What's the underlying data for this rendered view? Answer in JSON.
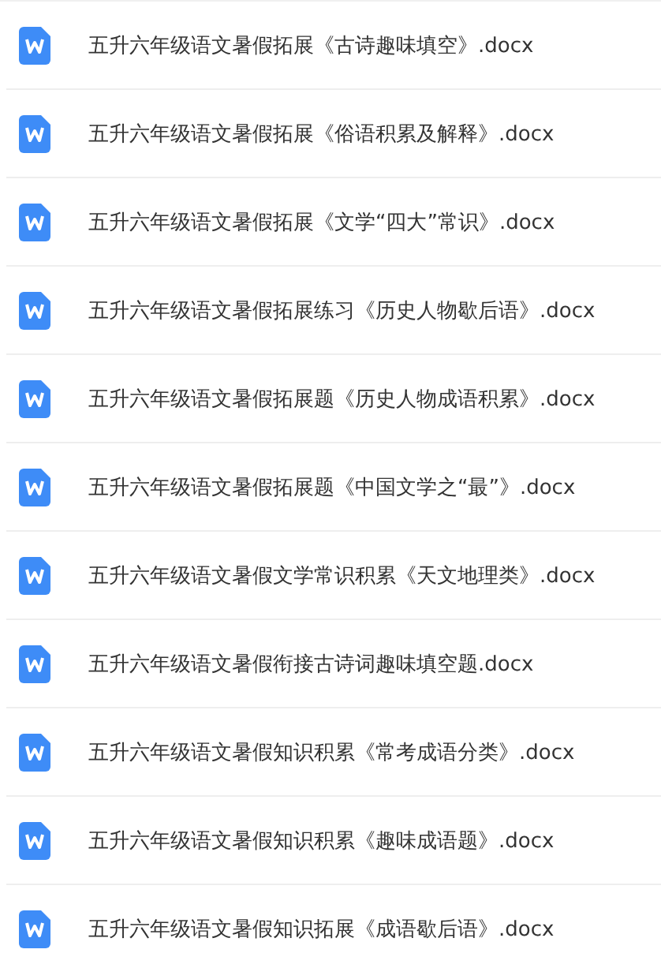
{
  "files": [
    {
      "name": "五升六年级语文暑假拓展《古诗趣味填空》.docx",
      "kind": "word"
    },
    {
      "name": "五升六年级语文暑假拓展《俗语积累及解释》.docx",
      "kind": "word"
    },
    {
      "name": "五升六年级语文暑假拓展《文学“四大”常识》.docx",
      "kind": "word"
    },
    {
      "name": "五升六年级语文暑假拓展练习《历史人物歇后语》.docx",
      "kind": "word"
    },
    {
      "name": "五升六年级语文暑假拓展题《历史人物成语积累》.docx",
      "kind": "word"
    },
    {
      "name": "五升六年级语文暑假拓展题《中国文学之“最”》.docx",
      "kind": "word"
    },
    {
      "name": "五升六年级语文暑假文学常识积累《天文地理类》.docx",
      "kind": "word"
    },
    {
      "name": "五升六年级语文暑假衔接古诗词趣味填空题.docx",
      "kind": "word"
    },
    {
      "name": "五升六年级语文暑假知识积累《常考成语分类》.docx",
      "kind": "word"
    },
    {
      "name": "五升六年级语文暑假知识积累《趣味成语题》.docx",
      "kind": "word"
    },
    {
      "name": "五升六年级语文暑假知识拓展《成语歇后语》.docx",
      "kind": "word"
    }
  ]
}
